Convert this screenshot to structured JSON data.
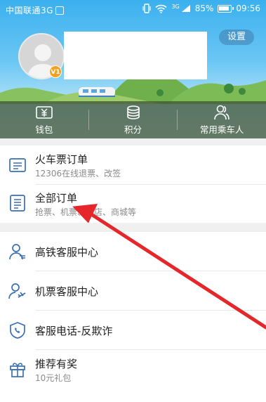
{
  "status_bar": {
    "carrier": "中国联通3G",
    "network": "3G",
    "battery": "85%",
    "time": "09:56"
  },
  "header": {
    "settings_label": "设置",
    "vip_badge": "V1"
  },
  "quick_actions": [
    {
      "label": "钱包",
      "icon": "wallet-icon"
    },
    {
      "label": "积分",
      "icon": "coins-icon"
    },
    {
      "label": "常用乘车人",
      "icon": "passengers-icon"
    }
  ],
  "orders": [
    {
      "title": "火车票订单",
      "subtitle": "12306在线退票、改签",
      "icon": "train-ticket-icon"
    },
    {
      "title": "全部订单",
      "subtitle": "抢票、机票、酒店、商城等",
      "icon": "order-list-icon"
    }
  ],
  "services": [
    {
      "title": "高铁客服中心",
      "icon": "rail-support-icon"
    },
    {
      "title": "机票客服中心",
      "icon": "flight-support-icon"
    },
    {
      "title": "客服电话-反欺诈",
      "icon": "shield-phone-icon"
    },
    {
      "title": "推荐有奖",
      "subtitle": "10元礼包",
      "icon": "gift-icon"
    }
  ],
  "colors": {
    "accent_sky": "#3bb0ee",
    "quickbar_bg": "#3a4e2e",
    "annotation_arrow": "#e5262a",
    "icon_blue": "#3a6fb2"
  }
}
